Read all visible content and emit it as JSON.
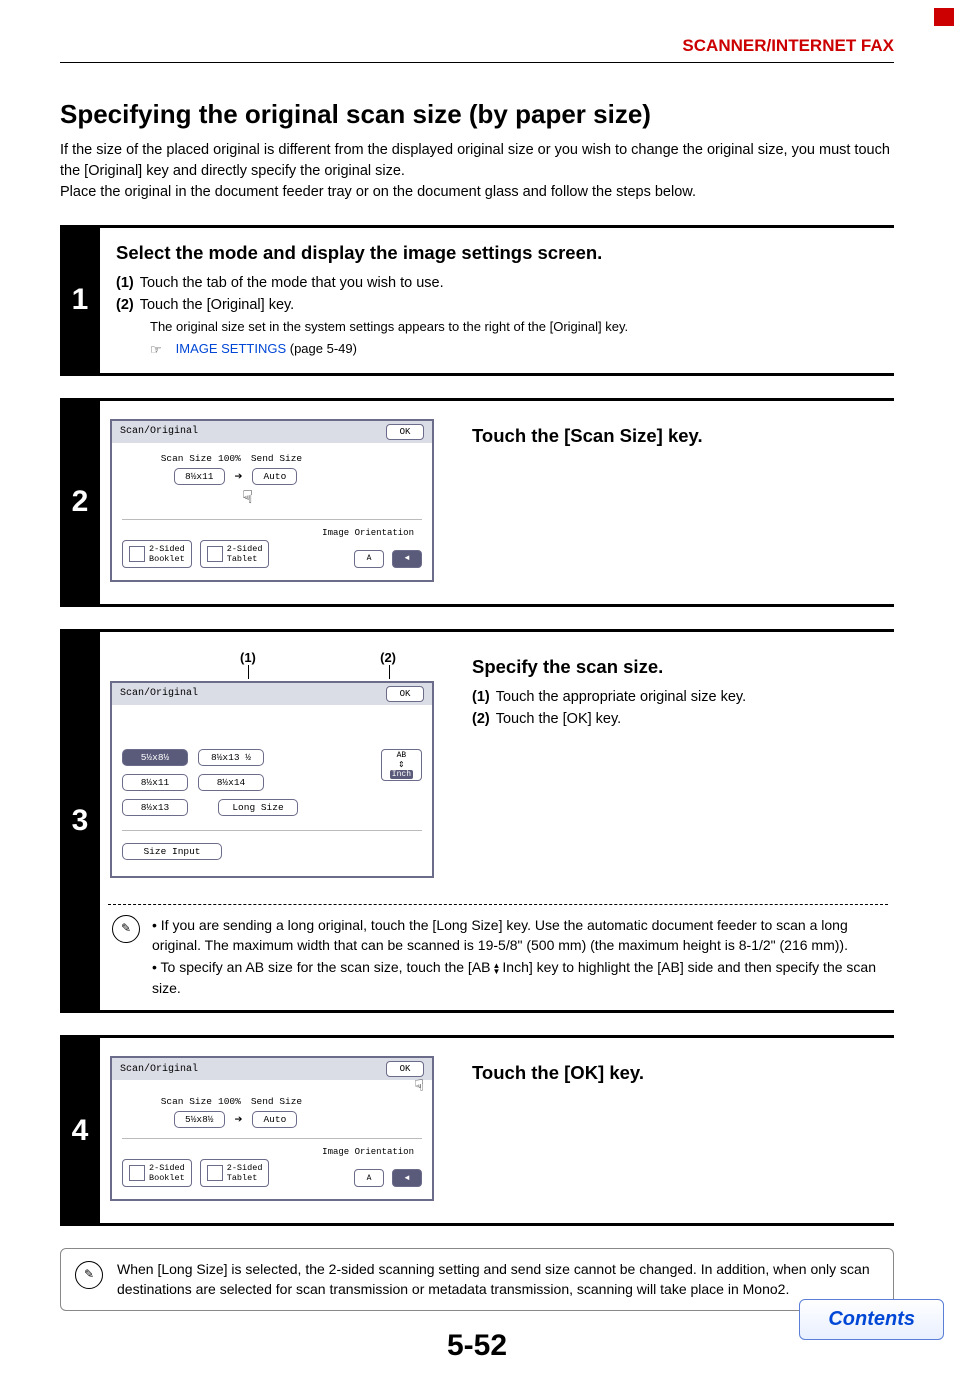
{
  "header": {
    "section": "SCANNER/INTERNET FAX"
  },
  "title": "Specifying the original scan size (by paper size)",
  "intro": "If the size of the placed original is different from the displayed original size or you wish to change the original size, you must touch the [Original] key and directly specify the original size.\nPlace the original in the document feeder tray or on the document glass and follow the steps below.",
  "steps": {
    "s1": {
      "num": "1",
      "title": "Select the mode and display the image settings screen.",
      "subs": [
        {
          "n": "(1)",
          "t": "Touch the tab of the mode that you wish to use."
        },
        {
          "n": "(2)",
          "t": "Touch the [Original] key."
        }
      ],
      "detail": "The original size set in the system settings appears to the right of the [Original] key.",
      "link": "IMAGE SETTINGS",
      "link_post": " (page 5-49)"
    },
    "s2": {
      "num": "2",
      "title": "Touch the [Scan Size] key.",
      "panel": {
        "title": "Scan/Original",
        "ok": "OK",
        "scan_label": "Scan Size",
        "scan_val": "8½x11",
        "ratio": "100%",
        "send_label": "Send Size",
        "send_val": "Auto",
        "orient_label": "Image Orientation",
        "dupA": "2-Sided\nBooklet",
        "dupB": "2-Sided\nTablet"
      }
    },
    "s3": {
      "num": "3",
      "title": "Specify the scan size.",
      "subs": [
        {
          "n": "(1)",
          "t": "Touch the appropriate original size key."
        },
        {
          "n": "(2)",
          "t": "Touch the [OK] key."
        }
      ],
      "callouts": {
        "c1": "(1)",
        "c2": "(2)"
      },
      "panel": {
        "title": "Scan/Original",
        "ok": "OK",
        "sizes": {
          "a": "5½x8½",
          "b": "8½x13 ½",
          "c": "8½x11",
          "d": "8½x14",
          "e": "8½x13",
          "long": "Long Size",
          "input": "Size Input",
          "ab": "AB",
          "inch": "Inch"
        }
      },
      "notes": [
        "If you are sending a long original, touch the [Long Size] key. Use the automatic document feeder to scan a long original. The maximum width that can be scanned is 19-5/8\" (500 mm) (the maximum height is 8-1/2\" (216 mm)).",
        "To specify an AB size for the scan size, touch the [AB      Inch] key to highlight the [AB] side and then specify the scan size."
      ]
    },
    "s4": {
      "num": "4",
      "title": "Touch the [OK] key.",
      "panel": {
        "title": "Scan/Original",
        "ok": "OK",
        "scan_label": "Scan Size",
        "scan_val": "5½x8½",
        "ratio": "100%",
        "send_label": "Send Size",
        "send_val": "Auto",
        "orient_label": "Image Orientation",
        "dupA": "2-Sided\nBooklet",
        "dupB": "2-Sided\nTablet"
      }
    }
  },
  "bottom_note": "When [Long Size] is selected, the 2-sided scanning setting and send size cannot be changed. In addition, when only scan destinations are selected for scan transmission or metadata transmission, scanning will take place in Mono2.",
  "page_num": "5-52",
  "contents": "Contents",
  "icons": {
    "pointer": "☞",
    "note": "✎",
    "hand": "☟",
    "hand_right": "☞",
    "orientA": "A",
    "orientB": "◄"
  }
}
